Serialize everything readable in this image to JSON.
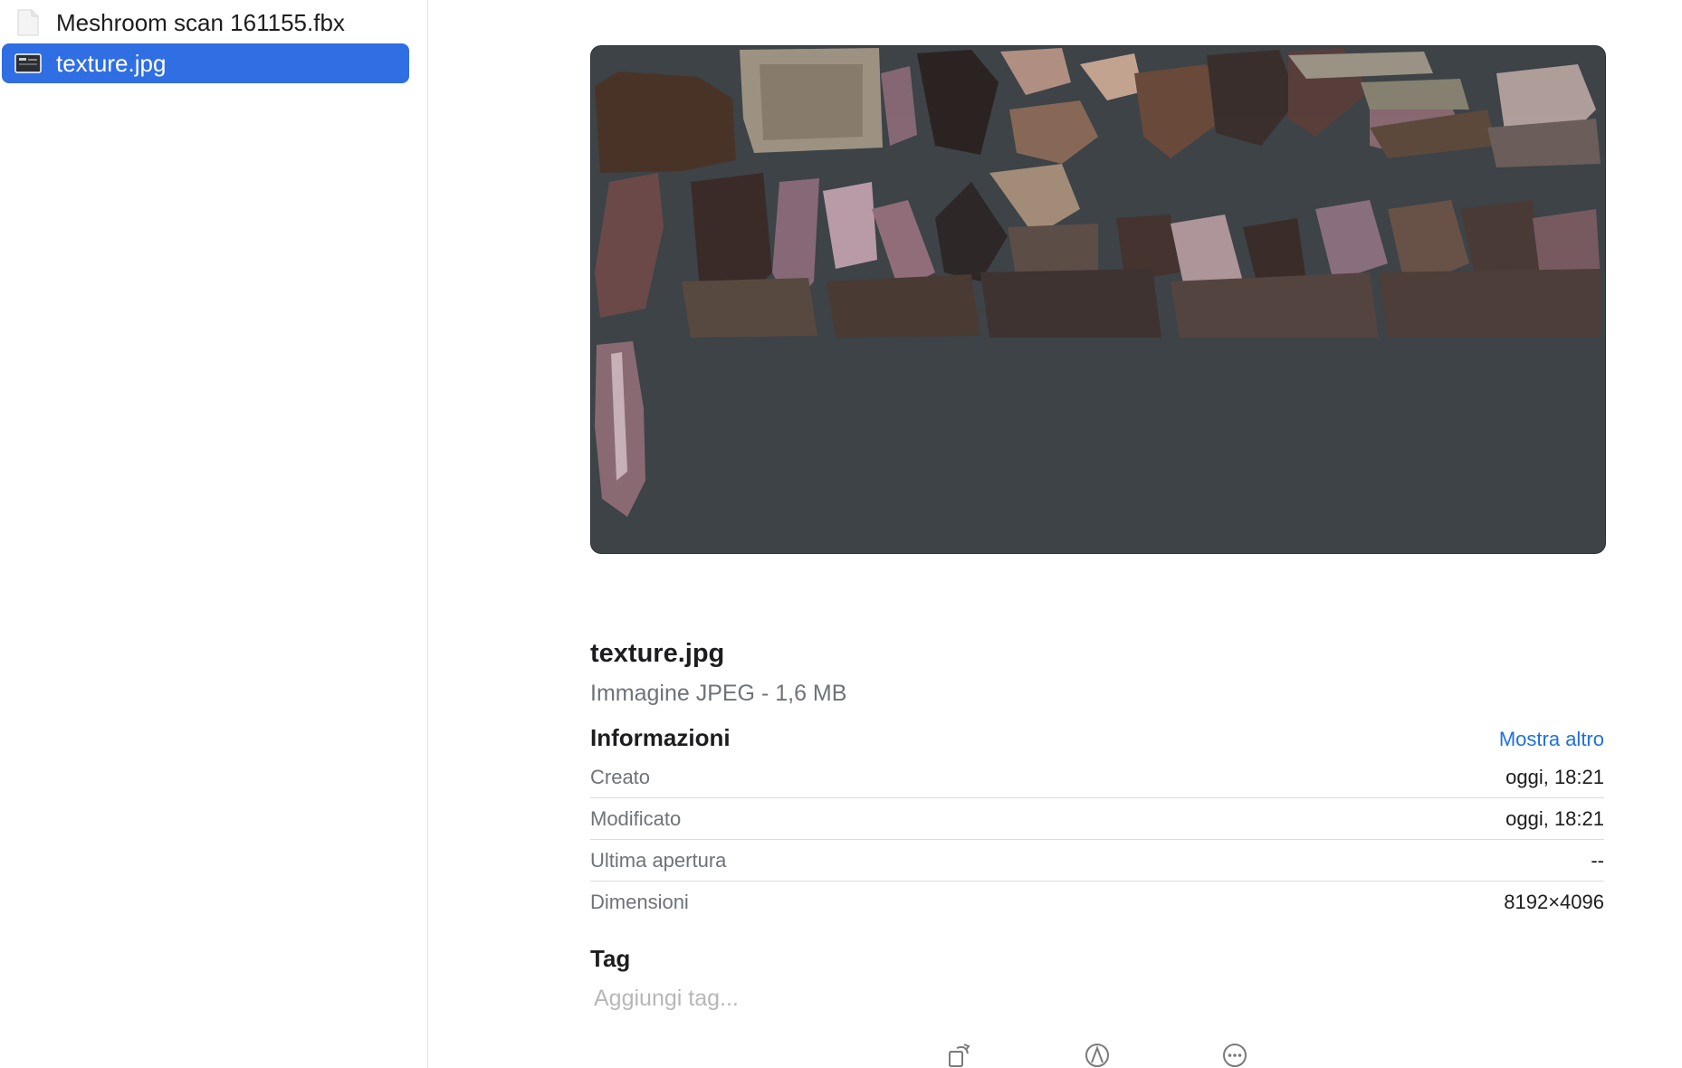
{
  "files": [
    {
      "name": "Meshroom scan 161155.fbx",
      "icon": "document-icon",
      "selected": false
    },
    {
      "name": "texture.jpg",
      "icon": "image-file-icon",
      "selected": true
    }
  ],
  "preview": {
    "background_color": "#3d4347",
    "content": "texture-atlas-image"
  },
  "file_info": {
    "title": "texture.jpg",
    "subtitle": "Immagine JPEG - 1,6 MB"
  },
  "info_section": {
    "title": "Informazioni",
    "show_more": "Mostra altro",
    "rows": [
      {
        "key": "Creato",
        "value": "oggi, 18:21"
      },
      {
        "key": "Modificato",
        "value": "oggi, 18:21"
      },
      {
        "key": "Ultima apertura",
        "value": "--"
      },
      {
        "key": "Dimensioni",
        "value": "8192×4096"
      }
    ]
  },
  "tags": {
    "title": "Tag",
    "placeholder": "Aggiungi tag..."
  },
  "actions": [
    {
      "icon": "rotate-icon"
    },
    {
      "icon": "markup-icon"
    },
    {
      "icon": "more-icon"
    }
  ],
  "colors": {
    "selection": "#2f6ee3",
    "link": "#1f6fe5",
    "secondary_text": "#6e7378"
  }
}
